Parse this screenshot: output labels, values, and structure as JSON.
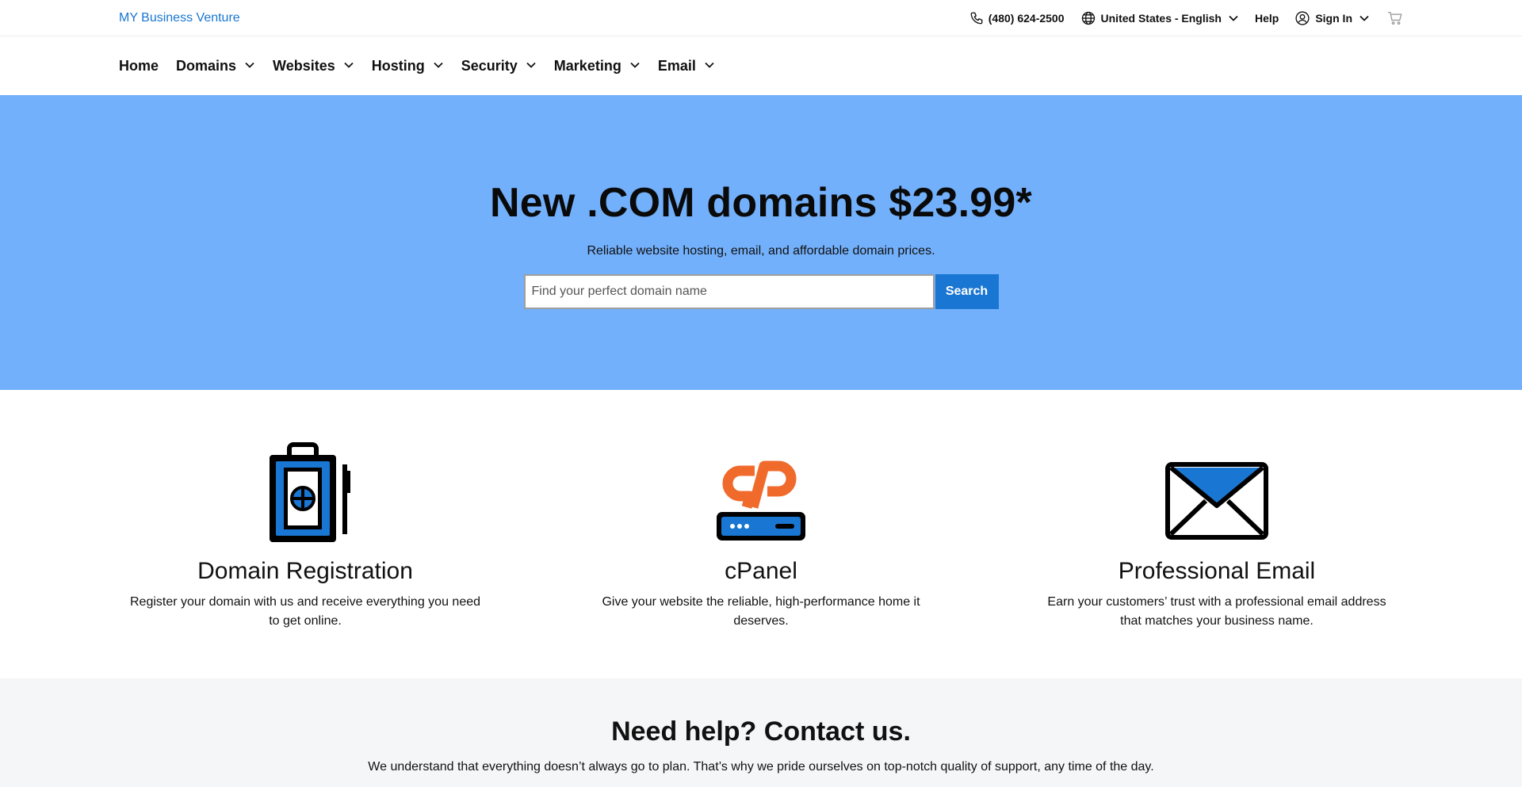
{
  "header": {
    "brand": "MY Business Venture",
    "phone": "(480) 624-2500",
    "locale": "United States - English",
    "help": "Help",
    "sign_in": "Sign In"
  },
  "nav": {
    "items": [
      {
        "label": "Home",
        "has_dropdown": false
      },
      {
        "label": "Domains",
        "has_dropdown": true
      },
      {
        "label": "Websites",
        "has_dropdown": true
      },
      {
        "label": "Hosting",
        "has_dropdown": true
      },
      {
        "label": "Security",
        "has_dropdown": true
      },
      {
        "label": "Marketing",
        "has_dropdown": true
      },
      {
        "label": "Email",
        "has_dropdown": true
      }
    ]
  },
  "hero": {
    "title": "New .COM domains $23.99*",
    "subtitle": "Reliable website hosting, email, and affordable domain prices.",
    "search_placeholder": "Find your perfect domain name",
    "search_button": "Search"
  },
  "features": [
    {
      "icon": "domain-registration-icon",
      "title": "Domain Registration",
      "text": "Register your domain with us and receive everything you need to get online."
    },
    {
      "icon": "cpanel-icon",
      "title": "cPanel",
      "text": "Give your website the reliable, high-performance home it deserves."
    },
    {
      "icon": "email-envelope-icon",
      "title": "Professional Email",
      "text": "Earn your customers’ trust with a professional email address that matches your business name."
    }
  ],
  "help": {
    "title": "Need help? Contact us.",
    "text": "We understand that everything doesn’t always go to plan. That’s why we pride ourselves on top-notch quality of support, any time of the day."
  },
  "colors": {
    "accent": "#1976d2",
    "hero_bg": "#73b0fb",
    "cpanel_orange": "#f06a2c",
    "help_bg": "#f5f6f8"
  }
}
